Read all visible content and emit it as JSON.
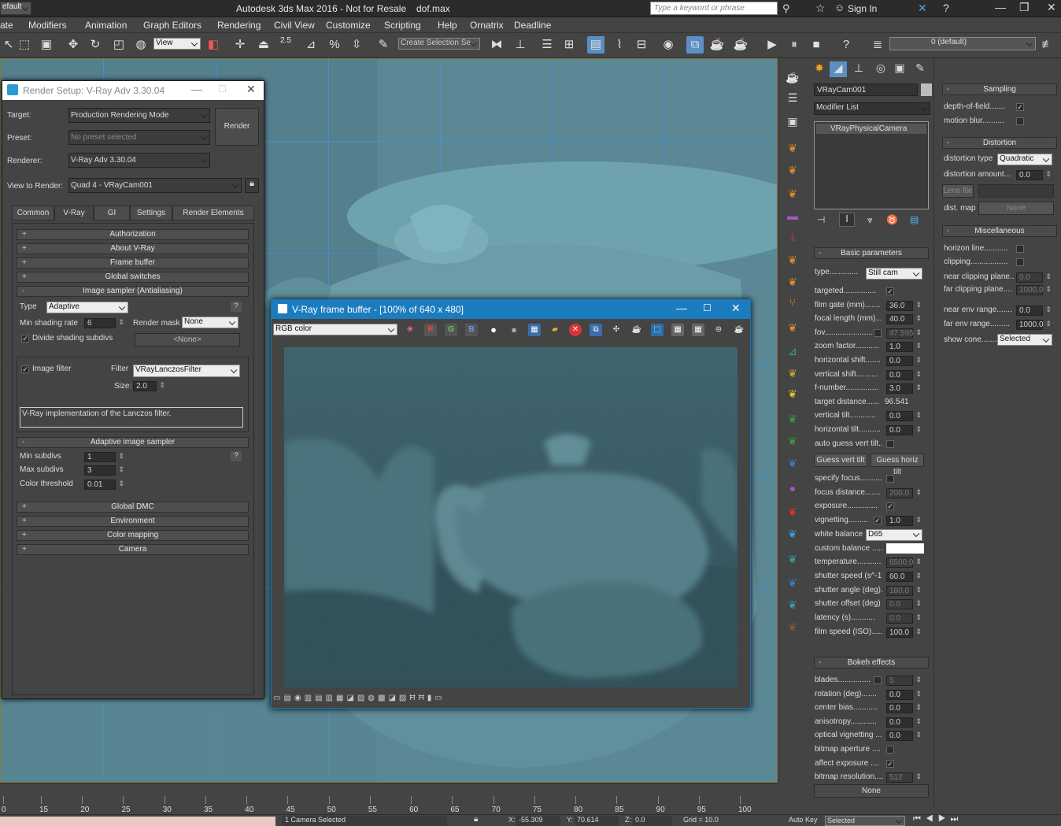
{
  "title_bar": {
    "workspace": "efault",
    "app_title": "Autodesk 3ds Max 2016 - Not for Resale",
    "file": "dof.max",
    "search_placeholder": "Type a keyword or phrase",
    "sign_in": "Sign In"
  },
  "menu": [
    "ate",
    "Modifiers",
    "Animation",
    "Graph Editors",
    "Rendering",
    "Civil View",
    "Customize",
    "Scripting",
    "Help",
    "Ornatrix",
    "Deadline"
  ],
  "toolbar": {
    "view_ref": "View",
    "snap_value": "2.5",
    "selection_set": "Create Selection Se",
    "layer": "0 (default)"
  },
  "render_setup": {
    "title": "Render Setup: V-Ray Adv 3.30.04",
    "target_label": "Target:",
    "target_value": "Production Rendering Mode",
    "preset_label": "Preset:",
    "preset_value": "No preset selected",
    "renderer_label": "Renderer:",
    "renderer_value": "V-Ray Adv 3.30.04",
    "view_label": "View to Render:",
    "view_value": "Quad 4 - VRayCam001",
    "render_button": "Render",
    "tabs": [
      "Common",
      "V-Ray",
      "GI",
      "Settings",
      "Render Elements"
    ],
    "rollouts_top": [
      "Authorization",
      "About V-Ray",
      "Frame buffer",
      "Global switches"
    ],
    "image_sampler": {
      "title": "Image sampler (Antialiasing)",
      "type_label": "Type",
      "type_value": "Adaptive",
      "min_shading_label": "Min shading rate",
      "min_shading_value": "6",
      "render_mask_label": "Render mask",
      "render_mask_value": "None",
      "divide_label": "Divide shading subdivs",
      "none_btn": "<None>",
      "image_filter_label": "Image filter",
      "filter_label": "Filter",
      "filter_value": "VRayLanczosFilter",
      "size_label": "Size:",
      "size_value": "2.0",
      "description": "V-Ray implementation of the Lanczos filter."
    },
    "adaptive": {
      "title": "Adaptive image sampler",
      "min_label": "Min subdivs",
      "min_value": "1",
      "max_label": "Max subdivs",
      "max_value": "3",
      "thresh_label": "Color threshold",
      "thresh_value": "0.01"
    },
    "rollouts_bottom": [
      "Global DMC",
      "Environment",
      "Color mapping",
      "Camera"
    ]
  },
  "vfb": {
    "title": "V-Ray frame buffer - [100% of 640 x 480]",
    "channel": "RGB color"
  },
  "command_panel": {
    "object_name": "VRayCam001",
    "modifier_list": "Modifier List",
    "stack_item": "VRayPhysicalCamera",
    "basic_title": "Basic parameters",
    "type_label": "type.............",
    "type_value": "Still cam",
    "params": [
      {
        "label": "targeted...............",
        "kind": "check",
        "value": "✓"
      },
      {
        "label": "film gate (mm).......",
        "kind": "spin",
        "value": "36.0"
      },
      {
        "label": "focal length (mm)...",
        "kind": "spin",
        "value": "40.0"
      },
      {
        "label": "fov......................",
        "kind": "spin-dis",
        "value": "47.595"
      },
      {
        "label": "zoom factor...........",
        "kind": "spin",
        "value": "1.0"
      },
      {
        "label": "horizontal shift.......",
        "kind": "spin",
        "value": "0.0"
      },
      {
        "label": "vertical shift..........",
        "kind": "spin",
        "value": "0.0"
      },
      {
        "label": "f-number...............",
        "kind": "spin",
        "value": "3.0"
      },
      {
        "label": "target distance......",
        "kind": "text",
        "value": "96.541"
      },
      {
        "label": "vertical tilt............",
        "kind": "spin",
        "value": "0.0"
      },
      {
        "label": "horizontal tilt..........",
        "kind": "spin",
        "value": "0.0"
      },
      {
        "label": "auto guess vert tilt..",
        "kind": "check",
        "value": ""
      }
    ],
    "guess_vert": "Guess vert tilt",
    "guess_horiz": "Guess horiz tilt",
    "params2": [
      {
        "label": "specify focus..........",
        "kind": "check",
        "value": ""
      },
      {
        "label": "focus distance.......",
        "kind": "spin-dis",
        "value": "200.0"
      },
      {
        "label": "exposure..............",
        "kind": "check",
        "value": "✓"
      },
      {
        "label": "vignetting.........",
        "kind": "checkspin",
        "value": "1.0"
      },
      {
        "label": "white balance",
        "kind": "dd",
        "value": "D65"
      },
      {
        "label": "custom balance .....",
        "kind": "swatch",
        "value": ""
      },
      {
        "label": "temperature...........",
        "kind": "spin-dis",
        "value": "6500.0"
      },
      {
        "label": "shutter speed (s^-1",
        "kind": "spin",
        "value": "60.0"
      },
      {
        "label": "shutter angle (deg).",
        "kind": "spin-dis",
        "value": "180.0"
      },
      {
        "label": "shutter offset (deg)",
        "kind": "spin-dis",
        "value": "0.0"
      },
      {
        "label": "latency (s)...........",
        "kind": "spin-dis",
        "value": "0.0"
      },
      {
        "label": "film speed (ISO).....",
        "kind": "spin",
        "value": "100.0"
      }
    ],
    "bokeh_title": "Bokeh effects",
    "bokeh": [
      {
        "label": "blades...............",
        "kind": "checkspin-dis",
        "value": "5"
      },
      {
        "label": "rotation (deg).......",
        "kind": "spin",
        "value": "0.0"
      },
      {
        "label": "center bias...........",
        "kind": "spin",
        "value": "0.0"
      },
      {
        "label": "anisotropy............",
        "kind": "spin",
        "value": "0.0"
      },
      {
        "label": "optical vignetting ...",
        "kind": "spin",
        "value": "0.0"
      },
      {
        "label": "bitmap aperture ....",
        "kind": "check",
        "value": ""
      },
      {
        "label": "affect exposure ....",
        "kind": "check",
        "value": "✓"
      },
      {
        "label": "bitmap resolution....",
        "kind": "spin-dis",
        "value": "512"
      }
    ],
    "none_btn": "None"
  },
  "right_panel": {
    "sampling_title": "Sampling",
    "dof_label": "depth-of-field.......",
    "motion_label": "motion blur..........",
    "distortion_title": "Distortion",
    "dist_type_label": "distortion type",
    "dist_type_value": "Quadratic",
    "dist_amount_label": "distortion amount...",
    "dist_amount_value": "0.0",
    "lens_file": "Lens file",
    "dist_map": "dist. map",
    "none": "None",
    "misc_title": "Miscellaneous",
    "horizon_label": "horizon line...........",
    "clipping_label": "clipping.................",
    "near_clip_label": "near clipping plane..",
    "near_clip_value": "0.0",
    "far_clip_label": "far clipping plane....",
    "far_clip_value": "1000.0",
    "near_env_label": "near env range.......",
    "near_env_value": "0.0",
    "far_env_label": "far env range.........",
    "far_env_value": "1000.0",
    "show_cone_label": "show cone........",
    "show_cone_value": "Selected"
  },
  "timeline": [
    "0",
    "15",
    "20",
    "25",
    "30",
    "35",
    "40",
    "45",
    "50",
    "55",
    "60",
    "65",
    "70",
    "75",
    "80",
    "85",
    "90",
    "95",
    "100"
  ],
  "status": {
    "selected": "1 Camera Selected",
    "x": "-55.309",
    "y": "70.614",
    "z": "0.0",
    "grid": "Grid = 10.0",
    "autokey": "Auto Key",
    "autokey_value": "Selected"
  }
}
